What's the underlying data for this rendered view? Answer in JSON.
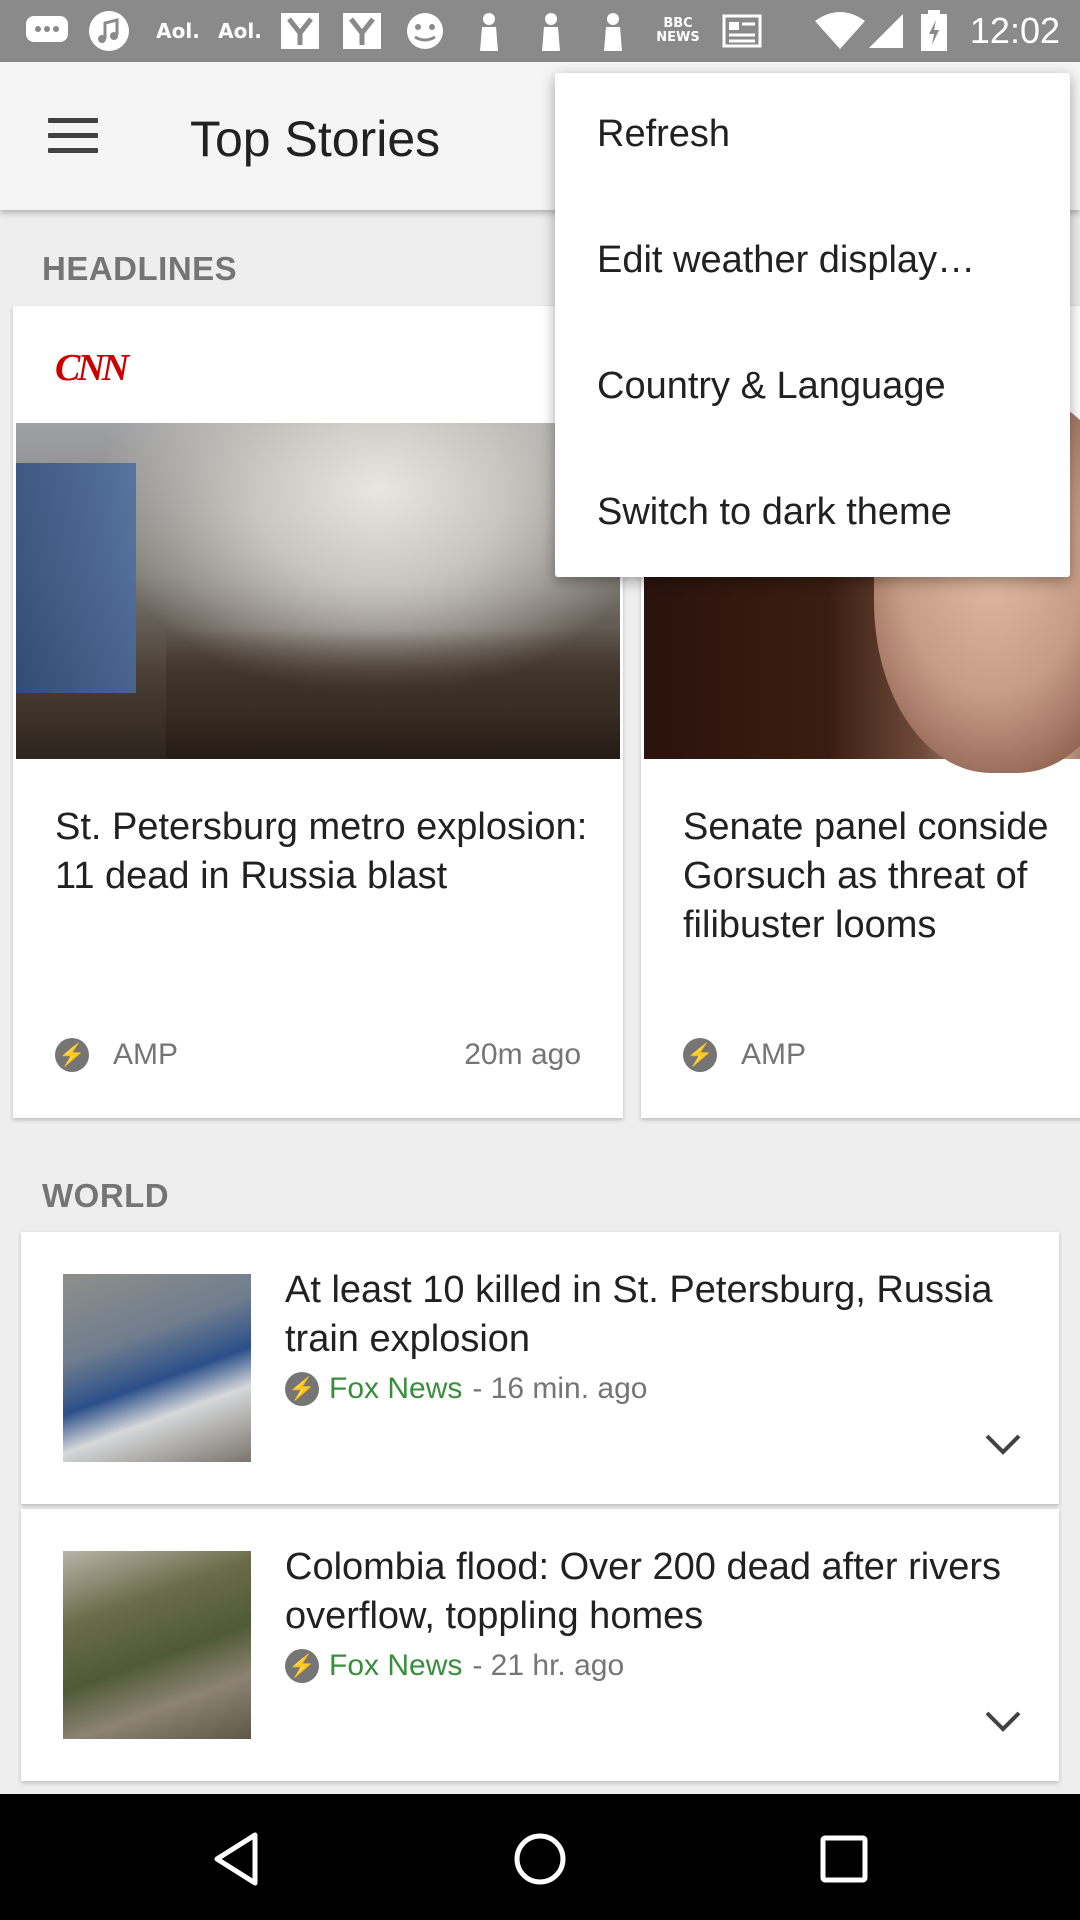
{
  "status_bar": {
    "aol1": "Aol.",
    "aol2": "Aol.",
    "bbc": "BBC NEWS",
    "time": "12:02"
  },
  "app_bar": {
    "title": "Top Stories"
  },
  "overflow_menu": {
    "items": [
      {
        "label": "Refresh"
      },
      {
        "label": "Edit weather display…"
      },
      {
        "label": "Country & Language"
      },
      {
        "label": "Switch to dark theme"
      }
    ]
  },
  "headlines": {
    "section_label": "HEADLINES",
    "cards": [
      {
        "source_logo": "CNN",
        "title": "St. Petersburg metro explosion: 11 dead in Russia blast",
        "amp": "AMP",
        "time": "20m ago"
      },
      {
        "title": "Senate panel considers Gorsuch as threat of filibuster looms",
        "amp": "AMP"
      }
    ]
  },
  "world": {
    "section_label": "WORLD",
    "items": [
      {
        "title": "At least 10 killed in St. Petersburg, Russia train explosion",
        "source": "Fox News",
        "time": "- 16 min. ago"
      },
      {
        "title": "Colombia flood: Over 200 dead after rivers overflow, toppling homes",
        "source": "Fox News",
        "time": "- 21 hr. ago"
      }
    ]
  },
  "colors": {
    "source_green": "#388e3c",
    "cnn_red": "#cc0000"
  },
  "icons": [
    "menu-icon",
    "amp-icon",
    "chevron-down-icon",
    "back-icon",
    "home-icon",
    "recents-icon"
  ]
}
